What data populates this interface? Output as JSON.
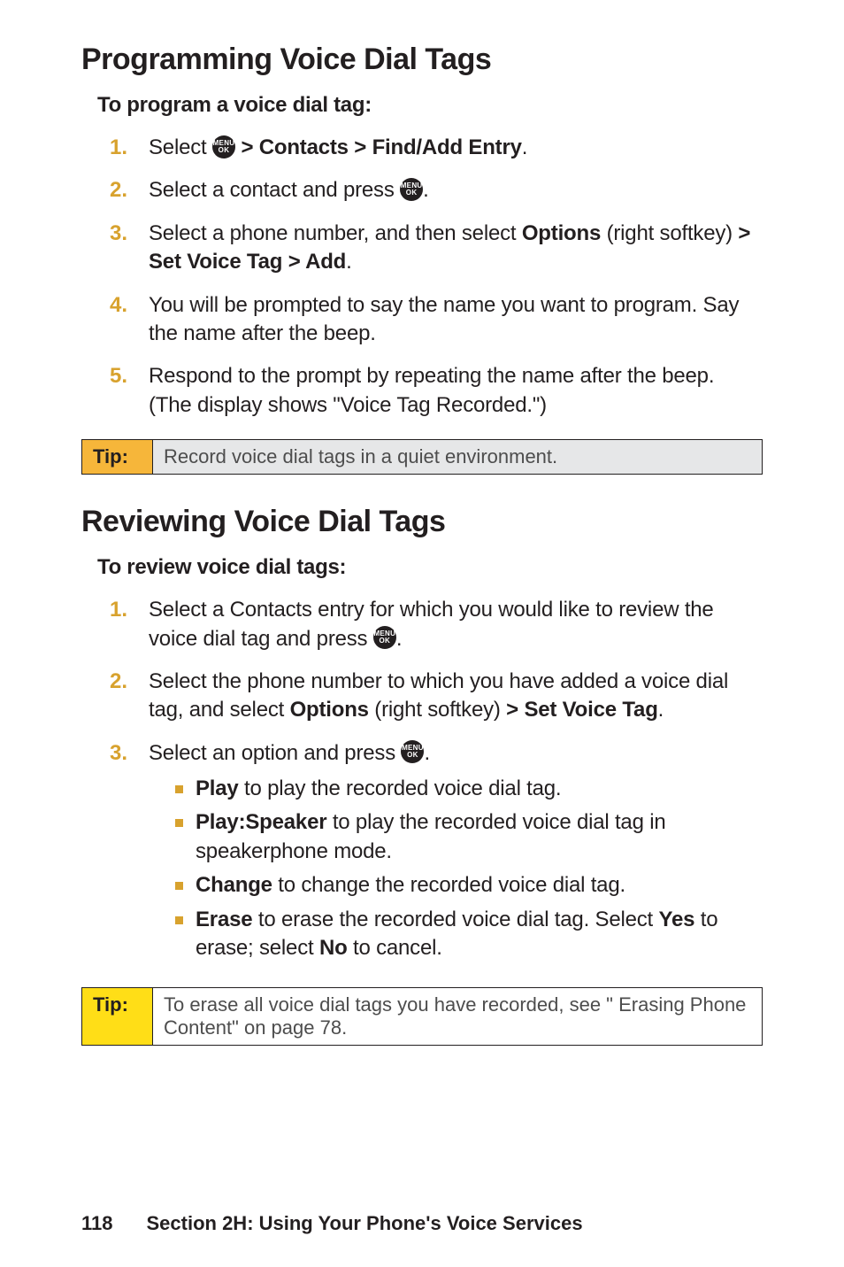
{
  "section1": {
    "heading": "Programming Voice Dial Tags",
    "lead": "To program a voice dial tag:",
    "steps": [
      {
        "num": "1.",
        "pre": "Select ",
        "post": " > Contacts > Find/Add Entry",
        "tail": "."
      },
      {
        "num": "2.",
        "pre": "Select a contact and press ",
        "tail": "."
      },
      {
        "num": "3.",
        "text_a": "Select a phone number, and then select ",
        "bold_a": "Options",
        "text_b": " (right softkey) ",
        "bold_b": "> Set Voice Tag > Add",
        "tail": "."
      },
      {
        "num": "4.",
        "plain": "You will be prompted to say the name you want to program. Say the name after the beep."
      },
      {
        "num": "5.",
        "plain": "Respond to the prompt by repeating the name after the beep. (The display shows \"Voice Tag Recorded.\")"
      }
    ],
    "tip_label": "Tip:",
    "tip_msg": "Record voice dial tags in a quiet environment."
  },
  "section2": {
    "heading": "Reviewing Voice Dial Tags",
    "lead": "To review voice dial tags:",
    "steps": [
      {
        "num": "1.",
        "pre": "Select a Contacts entry for which you would like to review the voice dial tag and press ",
        "tail": "."
      },
      {
        "num": "2.",
        "text_a": "Select the phone number to which you have added a voice dial tag, and select ",
        "bold_a": "Options",
        "text_b": " (right softkey) ",
        "bold_b": "> Set Voice Tag",
        "tail": "."
      },
      {
        "num": "3.",
        "pre": "Select an option and press ",
        "tail": ".",
        "bullets": [
          {
            "bold": "Play",
            "text": " to play the recorded voice dial tag."
          },
          {
            "bold": "Play:Speaker",
            "text": " to play the recorded voice dial tag in speakerphone mode."
          },
          {
            "bold": "Change",
            "text": " to change the recorded voice dial tag."
          },
          {
            "bold": "Erase",
            "text_a": " to erase the recorded voice dial tag. Select ",
            "bold_b": "Yes",
            "text_b": " to erase; select ",
            "bold_c": "No",
            "text_c": " to cancel."
          }
        ]
      }
    ],
    "tip_label": "Tip:",
    "tip_msg": "To erase all voice dial tags you have recorded, see \" Erasing Phone Content\" on page 78."
  },
  "footer": {
    "page": "118",
    "title": "Section 2H: Using Your Phone's Voice Services"
  }
}
